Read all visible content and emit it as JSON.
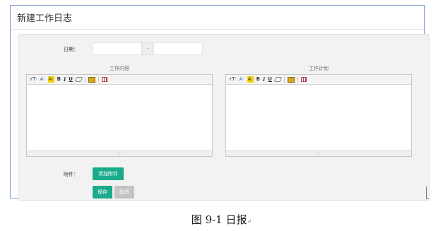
{
  "dialog": {
    "title": "新建工作日志"
  },
  "form": {
    "date_label": "日期：",
    "date_separator": "-",
    "date_start_value": "",
    "date_end_value": "",
    "work_content_label": "工作内容",
    "work_plan_label": "工作计划",
    "attachment_label": "附件：",
    "add_attachment_button": "添加附件",
    "save_button": "保存",
    "cancel_button": "取消"
  },
  "editor_toolbar": {
    "font_size": "тT·",
    "font_color": "A·",
    "bg_color": "A·",
    "bold": "B",
    "italic": "I",
    "underline": "U",
    "resize_handle": "·:·"
  },
  "caption": {
    "text": "图 9-1  日报",
    "mark": "↵"
  },
  "colors": {
    "accent_green": "#1aab8b",
    "disabled_gray": "#c4c4c4",
    "frame_border": "#7a9cc6"
  }
}
